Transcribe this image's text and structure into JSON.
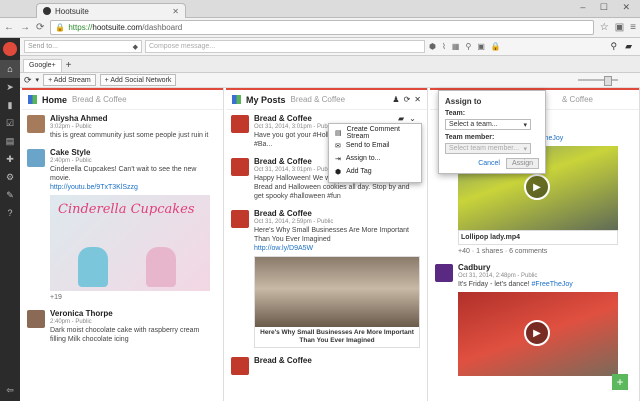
{
  "browser": {
    "tab_title": "Hootsuite",
    "url_secure": "https://",
    "url_host": "hootsuite.com",
    "url_path": "/dashboard"
  },
  "topbar": {
    "send_to_placeholder": "Send to...",
    "compose_placeholder": "Compose message..."
  },
  "tabs": {
    "google_tab": "Google+",
    "plus": "+"
  },
  "actions": {
    "add_stream": "+ Add Stream",
    "add_network": "+ Add Social Network"
  },
  "col1": {
    "title": "Home",
    "subtitle": "Bread & Coffee",
    "posts": [
      {
        "name": "Aliysha Ahmed",
        "meta": "3:02pm - Public",
        "text": "this is great community just some people just ruin it"
      },
      {
        "name": "Cake Style",
        "meta": "2:40pm - Public",
        "text": "Cinderella Cupcakes! Can't wait to see the new movie.",
        "link": "http://youtu.be/9TxT3KlSzzg"
      },
      {
        "name": "Veronica Thorpe",
        "meta": "2:40pm - Public",
        "text": "Dark moist chocolate cake with raspberry cream filling Milk chocolate icing"
      }
    ],
    "plus_count": "+19",
    "image_caption": "Cinderella Cupcakes"
  },
  "col2": {
    "title": "My Posts",
    "subtitle": "Bread & Coffee",
    "posts": [
      {
        "name": "Bread & Coffee",
        "meta": "Oct 31, 2014, 3:01pm - Public",
        "text": "Have you got your #Hollo... they are going quick #Ba..."
      },
      {
        "name": "Bread & Coffee",
        "meta": "Oct 31, 2014, 3:01pm - Public",
        "text": "Happy Halloween! We will be rooting up Pumpkin Bread and Halloween cookies all day. Stop by and get spooky #halloween #fun"
      },
      {
        "name": "Bread & Coffee",
        "meta": "Oct 31, 2014, 2:59pm - Public",
        "text": "Here's Why Small Businesses Are More Important Than You Ever Imagined",
        "link": "http://ow.ly/D9A5W"
      },
      {
        "name": "Bread & Coffee",
        "meta": "",
        "text": ""
      }
    ],
    "article_caption": "Here's Why Small Businesses Are More Important Than You Ever Imagined"
  },
  "dropdown": {
    "items": [
      "Create Comment Stream",
      "Send to Email",
      "Assign to...",
      "Add Tag"
    ]
  },
  "assign": {
    "title": "Assign to",
    "team_label": "Team:",
    "team_value": "Select a team...",
    "member_label": "Team member:",
    "member_value": "Select team member...",
    "cancel": "Cancel",
    "assign": "Assign"
  },
  "col3": {
    "title": "Bread & Coffee",
    "header_partial": "& Coffee",
    "link_partial": "#FreeTheJoy",
    "video1_caption": "Lollipop lady.mp4",
    "stats": "+40 · 1 shares · 6 comments",
    "post2_name": "Cadbury",
    "post2_meta": "Oct 31, 2014, 2:48pm - Public",
    "post2_text": "It's Friday - let's dance!",
    "post2_link": "#FreeTheJoy"
  },
  "fab": "+",
  "colors": {
    "accent": "#e04a3a",
    "link": "#1a6fc7",
    "sidebar": "#2b2b2b"
  }
}
